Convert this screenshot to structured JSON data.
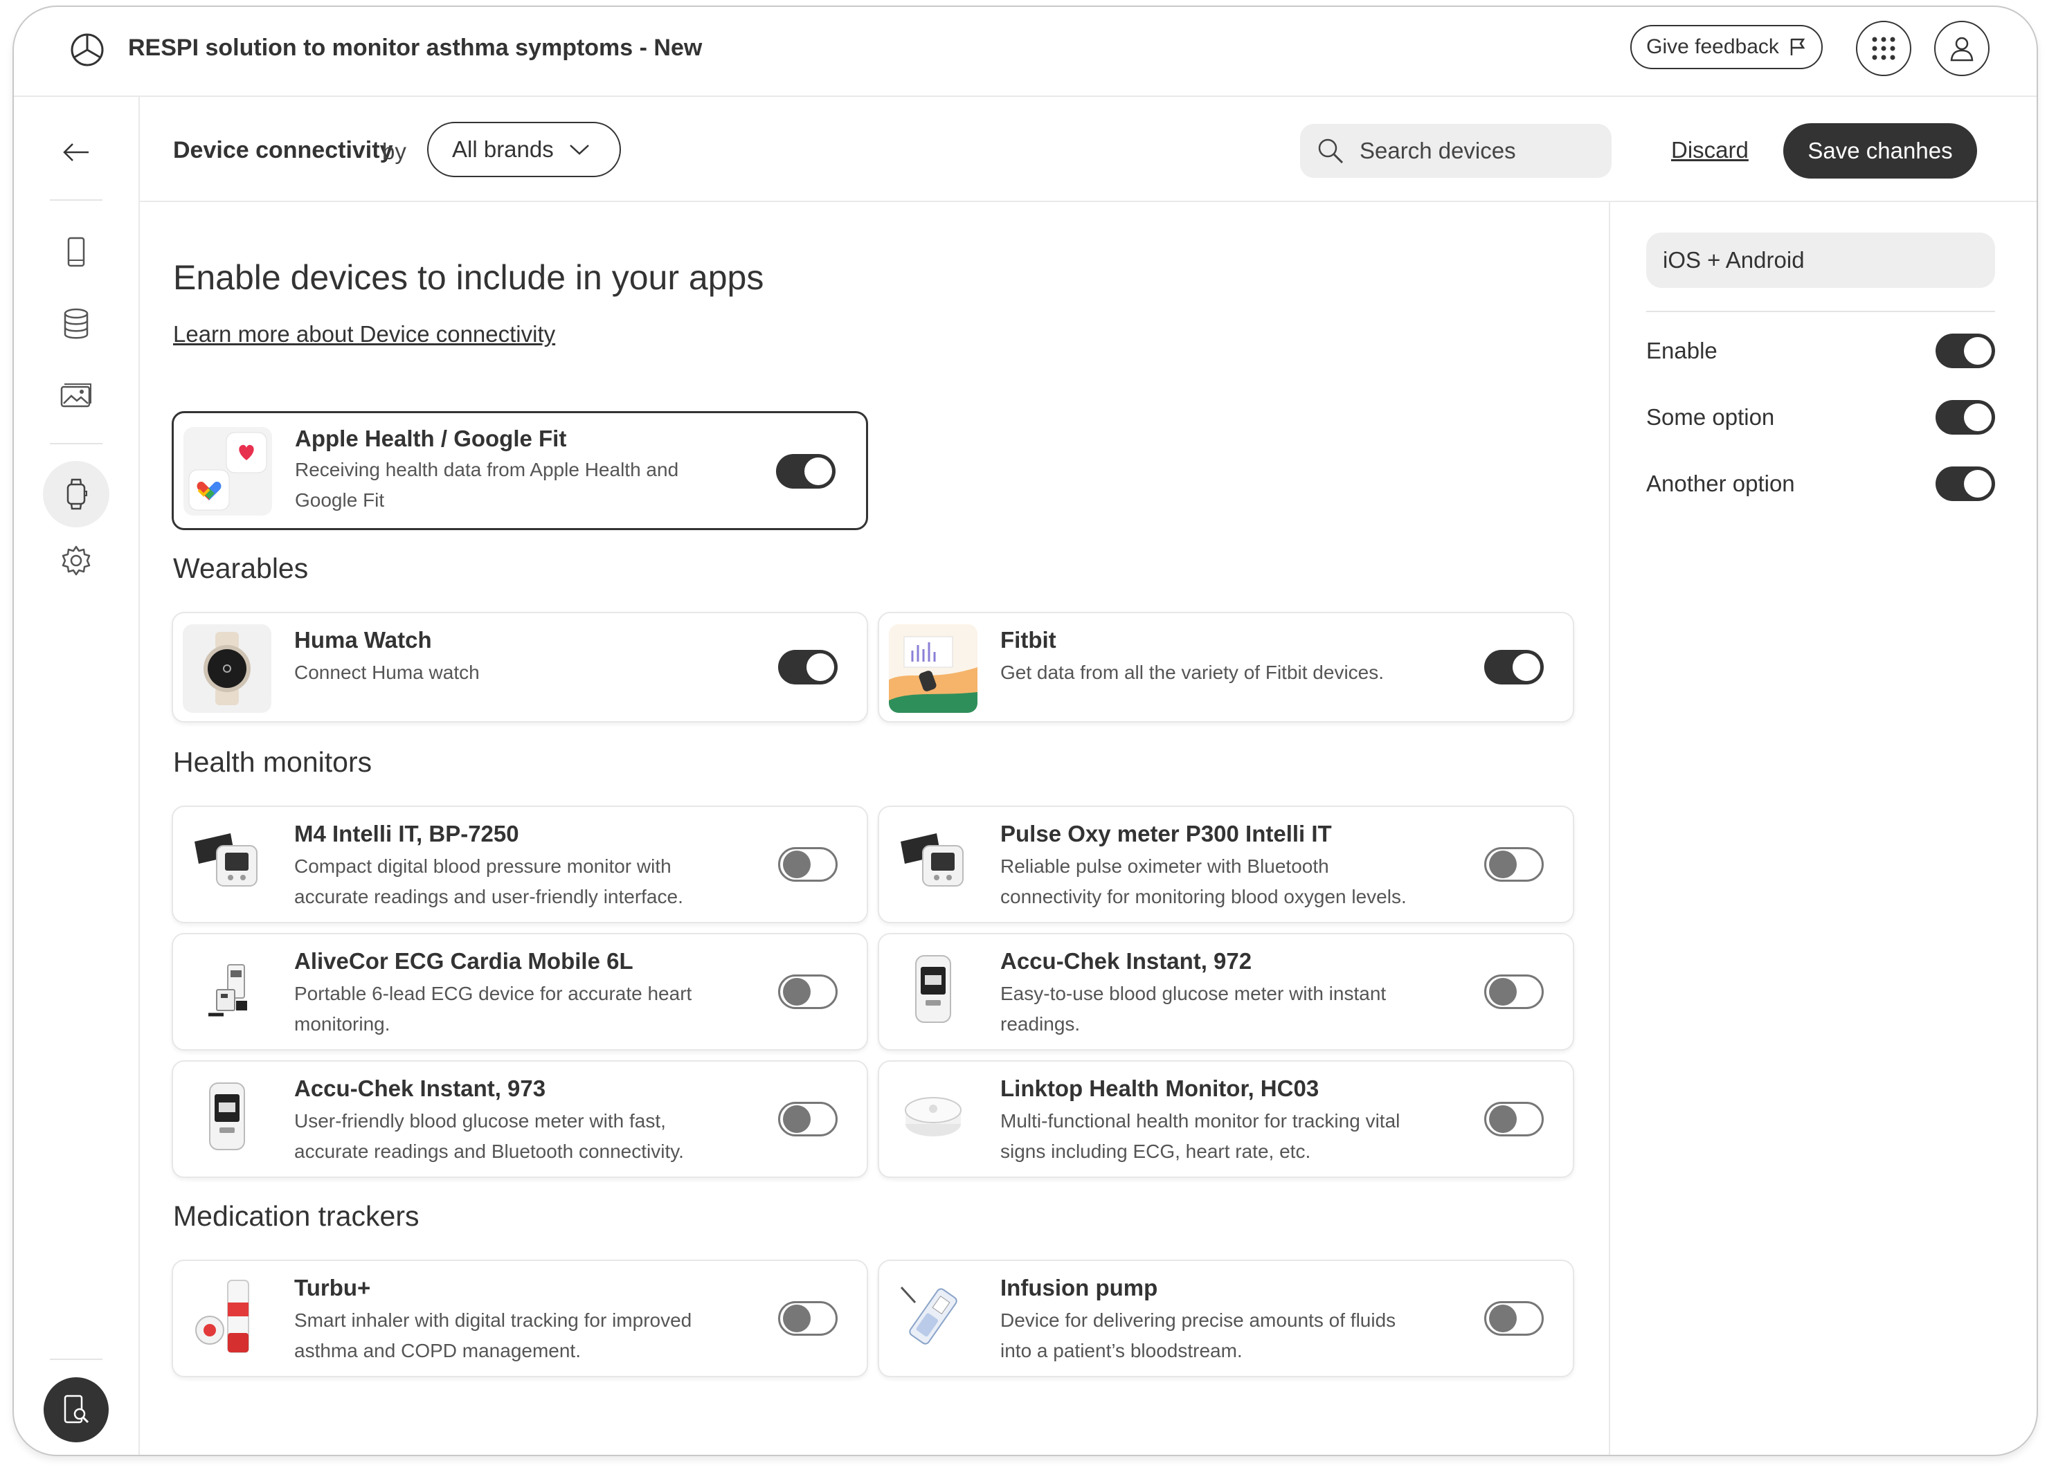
{
  "app": {
    "title": "RESPI solution to monitor asthma symptoms - New"
  },
  "header": {
    "feedback_label": "Give feedback",
    "apps_icon": "apps-grid-icon",
    "profile_icon": "user-icon"
  },
  "subheader": {
    "section_label": "Device connectivity",
    "by_label": "by",
    "brand_select_value": "All brands",
    "search_placeholder": "Search devices",
    "discard_label": "Discard",
    "save_label": "Save chanhes"
  },
  "main": {
    "title": "Enable devices to include in your apps",
    "learn_link": "Learn more about Device connectivity",
    "featured": {
      "name": "Apple Health / Google Fit",
      "desc": "Receiving health data from Apple Health and Google Fit",
      "enabled": true
    },
    "sections": [
      {
        "title": "Wearables",
        "items": [
          {
            "name": "Huma Watch",
            "desc": "Connect Huma watch",
            "enabled": true
          },
          {
            "name": "Fitbit",
            "desc": "Get data from all the variety of Fitbit devices.",
            "enabled": true
          }
        ]
      },
      {
        "title": "Health monitors",
        "items": [
          {
            "name": "M4 Intelli IT, BP-7250",
            "desc": "Compact digital blood pressure monitor with accurate readings and user-friendly interface.",
            "enabled": false
          },
          {
            "name": "Pulse Oxy meter P300 Intelli IT",
            "desc": "Reliable pulse oximeter with Bluetooth connectivity for monitoring blood oxygen levels.",
            "enabled": false
          },
          {
            "name": "AliveCor ECG Cardia Mobile 6L",
            "desc": "Portable 6-lead ECG device for accurate heart monitoring.",
            "enabled": false
          },
          {
            "name": "Accu-Chek Instant, 972",
            "desc": "Easy-to-use blood glucose meter with instant readings.",
            "enabled": false
          },
          {
            "name": "Accu-Chek Instant, 973",
            "desc": "User-friendly blood glucose meter with fast, accurate readings and Bluetooth connectivity.",
            "enabled": false
          },
          {
            "name": "Linktop Health Monitor, HC03",
            "desc": "Multi-functional health monitor for tracking vital signs including ECG, heart rate, etc.",
            "enabled": false
          }
        ]
      },
      {
        "title": "Medication trackers",
        "items": [
          {
            "name": "Turbu+",
            "desc": "Smart inhaler with digital tracking for improved asthma and COPD management.",
            "enabled": false
          },
          {
            "name": "Infusion pump",
            "desc": "Device for delivering precise amounts of fluids into a patient’s bloodstream.",
            "enabled": false
          }
        ]
      }
    ]
  },
  "panel": {
    "platform": "iOS + Android",
    "options": [
      {
        "label": "Enable",
        "enabled": true
      },
      {
        "label": "Some option",
        "enabled": true
      },
      {
        "label": "Another option",
        "enabled": true
      }
    ]
  },
  "colors": {
    "accent": "#333333",
    "muted_bg": "#eeeeee",
    "border": "#e7e7e7"
  }
}
